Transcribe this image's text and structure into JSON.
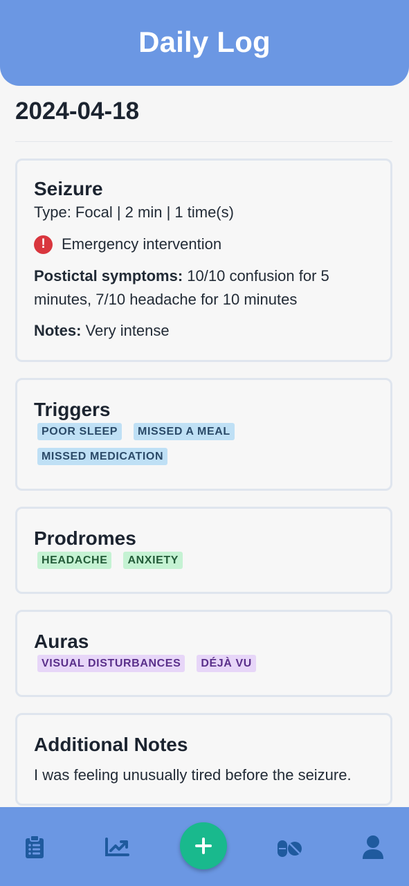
{
  "header": {
    "title": "Daily Log"
  },
  "date": "2024-04-18",
  "seizure": {
    "title": "Seizure",
    "summary": "Type: Focal | 2 min | 1 time(s)",
    "emergency": "Emergency intervention",
    "postictal_label": "Postictal symptoms:",
    "postictal_value": " 10/10 confusion for 5 minutes, 7/10 headache for 10 minutes",
    "notes_label": "Notes:",
    "notes_value": " Very intense"
  },
  "triggers": {
    "title": "Triggers",
    "tags": [
      "POOR SLEEP",
      "MISSED A MEAL",
      "MISSED MEDICATION"
    ]
  },
  "prodromes": {
    "title": "Prodromes",
    "tags": [
      "HEADACHE",
      "ANXIETY"
    ]
  },
  "auras": {
    "title": "Auras",
    "tags": [
      "VISUAL DISTURBANCES",
      "DÉJÀ VU"
    ]
  },
  "additional_notes": {
    "title": "Additional Notes",
    "text": "I was feeling unusually tired before the seizure."
  },
  "nav": {
    "items": [
      {
        "icon": "clipboard-list-icon"
      },
      {
        "icon": "chart-line-icon"
      },
      {
        "icon": "plus-icon"
      },
      {
        "icon": "pills-icon"
      },
      {
        "icon": "user-icon"
      }
    ]
  },
  "colors": {
    "primary": "#6b97e3",
    "fab": "#19b98d",
    "alert": "#d9363e",
    "nav_icon": "#1f5a9e"
  }
}
